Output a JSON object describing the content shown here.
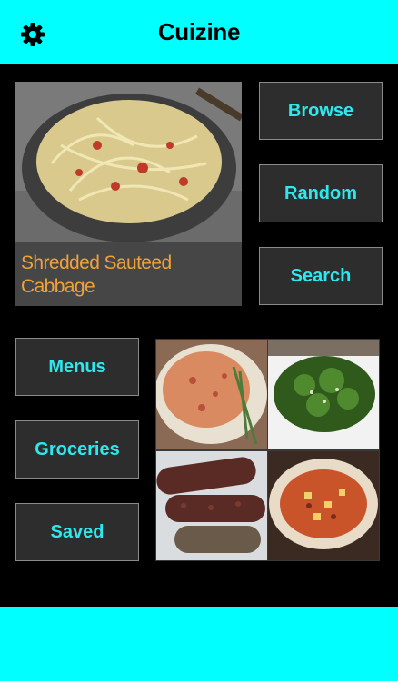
{
  "app": {
    "title": "Cuizine"
  },
  "icons": {
    "settings": "gear-icon"
  },
  "featured": {
    "title": "Shredded Sauteed Cabbage"
  },
  "buttons": {
    "browse": "Browse",
    "random": "Random",
    "search": "Search",
    "menus": "Menus",
    "groceries": "Groceries",
    "saved": "Saved"
  },
  "colors": {
    "accent": "#00FFFF",
    "button_text": "#2EE8EE",
    "caption_text": "#F0A23A",
    "background": "#000000"
  }
}
